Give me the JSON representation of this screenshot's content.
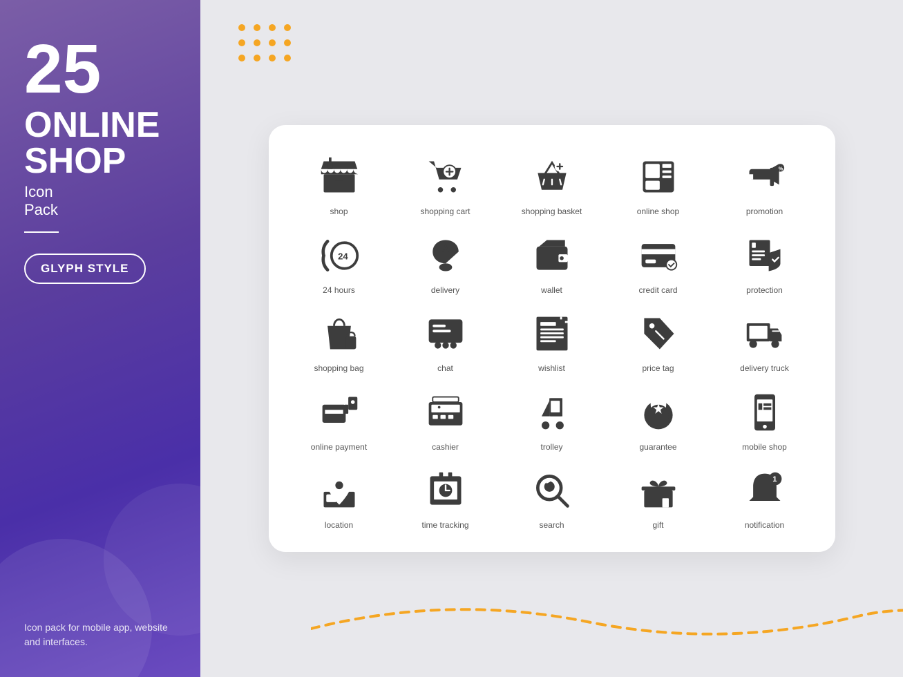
{
  "left": {
    "number": "25",
    "line1": "ONLINE",
    "line2": "SHOP",
    "line3": "Icon",
    "line4": "Pack",
    "glyph_label": "GLYPH STYLE",
    "bottom_text": "Icon pack for mobile app, website\nand interfaces."
  },
  "icons": [
    {
      "id": "shop",
      "label": "shop"
    },
    {
      "id": "shopping-cart",
      "label": "shopping cart"
    },
    {
      "id": "shopping-basket",
      "label": "shopping basket"
    },
    {
      "id": "online-shop",
      "label": "online shop"
    },
    {
      "id": "promotion",
      "label": "promotion"
    },
    {
      "id": "24hours",
      "label": "24 hours"
    },
    {
      "id": "delivery",
      "label": "delivery"
    },
    {
      "id": "wallet",
      "label": "wallet"
    },
    {
      "id": "credit-card",
      "label": "credit card"
    },
    {
      "id": "protection",
      "label": "protection"
    },
    {
      "id": "shopping-bag",
      "label": "shopping bag"
    },
    {
      "id": "chat",
      "label": "chat"
    },
    {
      "id": "wishlist",
      "label": "wishlist"
    },
    {
      "id": "price-tag",
      "label": "price tag"
    },
    {
      "id": "delivery-truck",
      "label": "delivery truck"
    },
    {
      "id": "online-payment",
      "label": "online payment"
    },
    {
      "id": "cashier",
      "label": "cashier"
    },
    {
      "id": "trolley",
      "label": "trolley"
    },
    {
      "id": "guarantee",
      "label": "guarantee"
    },
    {
      "id": "mobile-shop",
      "label": "mobile shop"
    },
    {
      "id": "location",
      "label": "location"
    },
    {
      "id": "time-tracking",
      "label": "time tracking"
    },
    {
      "id": "search",
      "label": "search"
    },
    {
      "id": "gift",
      "label": "gift"
    },
    {
      "id": "notification",
      "label": "notification"
    }
  ]
}
